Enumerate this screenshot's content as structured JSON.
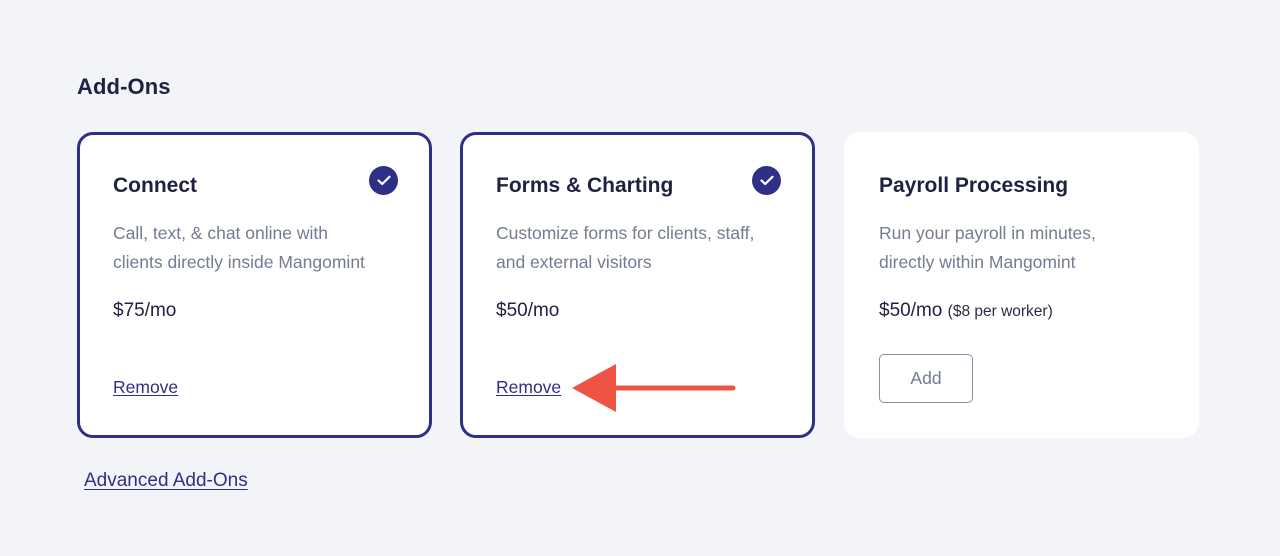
{
  "section": {
    "title": "Add-Ons"
  },
  "cards": [
    {
      "title": "Connect",
      "description_line1": "Call, text, & chat online with",
      "description_line2": "clients directly inside Mangomint",
      "price": "$75/mo",
      "selected": true,
      "action_label": "Remove"
    },
    {
      "title": "Forms & Charting",
      "description_line1": "Customize forms for clients, staff,",
      "description_line2": "and external visitors",
      "price": "$50/mo",
      "selected": true,
      "action_label": "Remove"
    },
    {
      "title": "Payroll Processing",
      "description_line1": "Run your payroll in minutes,",
      "description_line2": "directly within Mangomint",
      "price": "$50/mo",
      "price_note": "($8 per worker)",
      "selected": false,
      "action_label": "Add"
    }
  ],
  "footer": {
    "advanced_link": "Advanced Add-Ons"
  },
  "icons": {
    "selected_check": "check-circle-icon",
    "annotation": "arrow-left-icon"
  },
  "colors": {
    "background": "#f3f4f7",
    "accent": "#2e2f86",
    "annotation_arrow": "#ef5343",
    "muted_text": "#747b92",
    "heading_text": "#1f2140"
  }
}
